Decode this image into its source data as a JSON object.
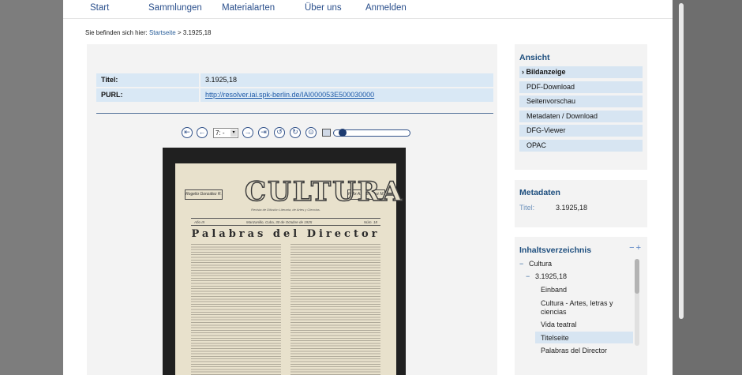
{
  "nav": [
    "Start",
    "Sammlungen",
    "Materialarten",
    "Über uns",
    "Anmelden"
  ],
  "breadcrumb": {
    "prefix": "Sie befinden sich hier:",
    "link": "Startseite",
    "current": "> 3.1925,18"
  },
  "meta": {
    "title_label": "Titel:",
    "title_value": "3.1925,18",
    "purl_label": "PURL:",
    "purl_value": "http://resolver.iai.spk-berlin.de/IAI000053E500030000"
  },
  "toolbar": {
    "page_select": "7: -",
    "zoom_level": 0.05
  },
  "scan": {
    "masthead": "CULTURA",
    "name_left": "Rogelio González R.",
    "name_right": "Félix A. González M.",
    "subtitle": "Revista de Difusión Literaria, de Artes y Ciencias.",
    "issue_left": "Año III",
    "issue_mid": "Manzanillo, Cuba, 30 de Octubre de 1925",
    "issue_right": "Núm. 18",
    "headline": "Palabras del Director"
  },
  "sidebar": {
    "ansicht": {
      "title": "Ansicht",
      "items": [
        "› Bildanzeige",
        "PDF-Download",
        "Seitenvorschau",
        "Metadaten / Download",
        "DFG-Viewer",
        "OPAC"
      ]
    },
    "metadaten": {
      "title": "Metadaten",
      "key": "Titel:",
      "value": "3.1925,18"
    },
    "toc": {
      "title": "Inhaltsverzeichnis",
      "controls": "−+",
      "items": [
        {
          "prefix": "−",
          "label": "Cultura"
        },
        {
          "prefix": "−",
          "label": "3.1925,18"
        },
        {
          "prefix": "",
          "label": "Einband"
        },
        {
          "prefix": "",
          "label": "Cultura - Artes, letras y ciencias"
        },
        {
          "prefix": "",
          "label": "Vida teatral"
        },
        {
          "prefix": "",
          "label": "Titelseite"
        },
        {
          "prefix": "",
          "label": "Palabras del Director"
        }
      ]
    }
  }
}
